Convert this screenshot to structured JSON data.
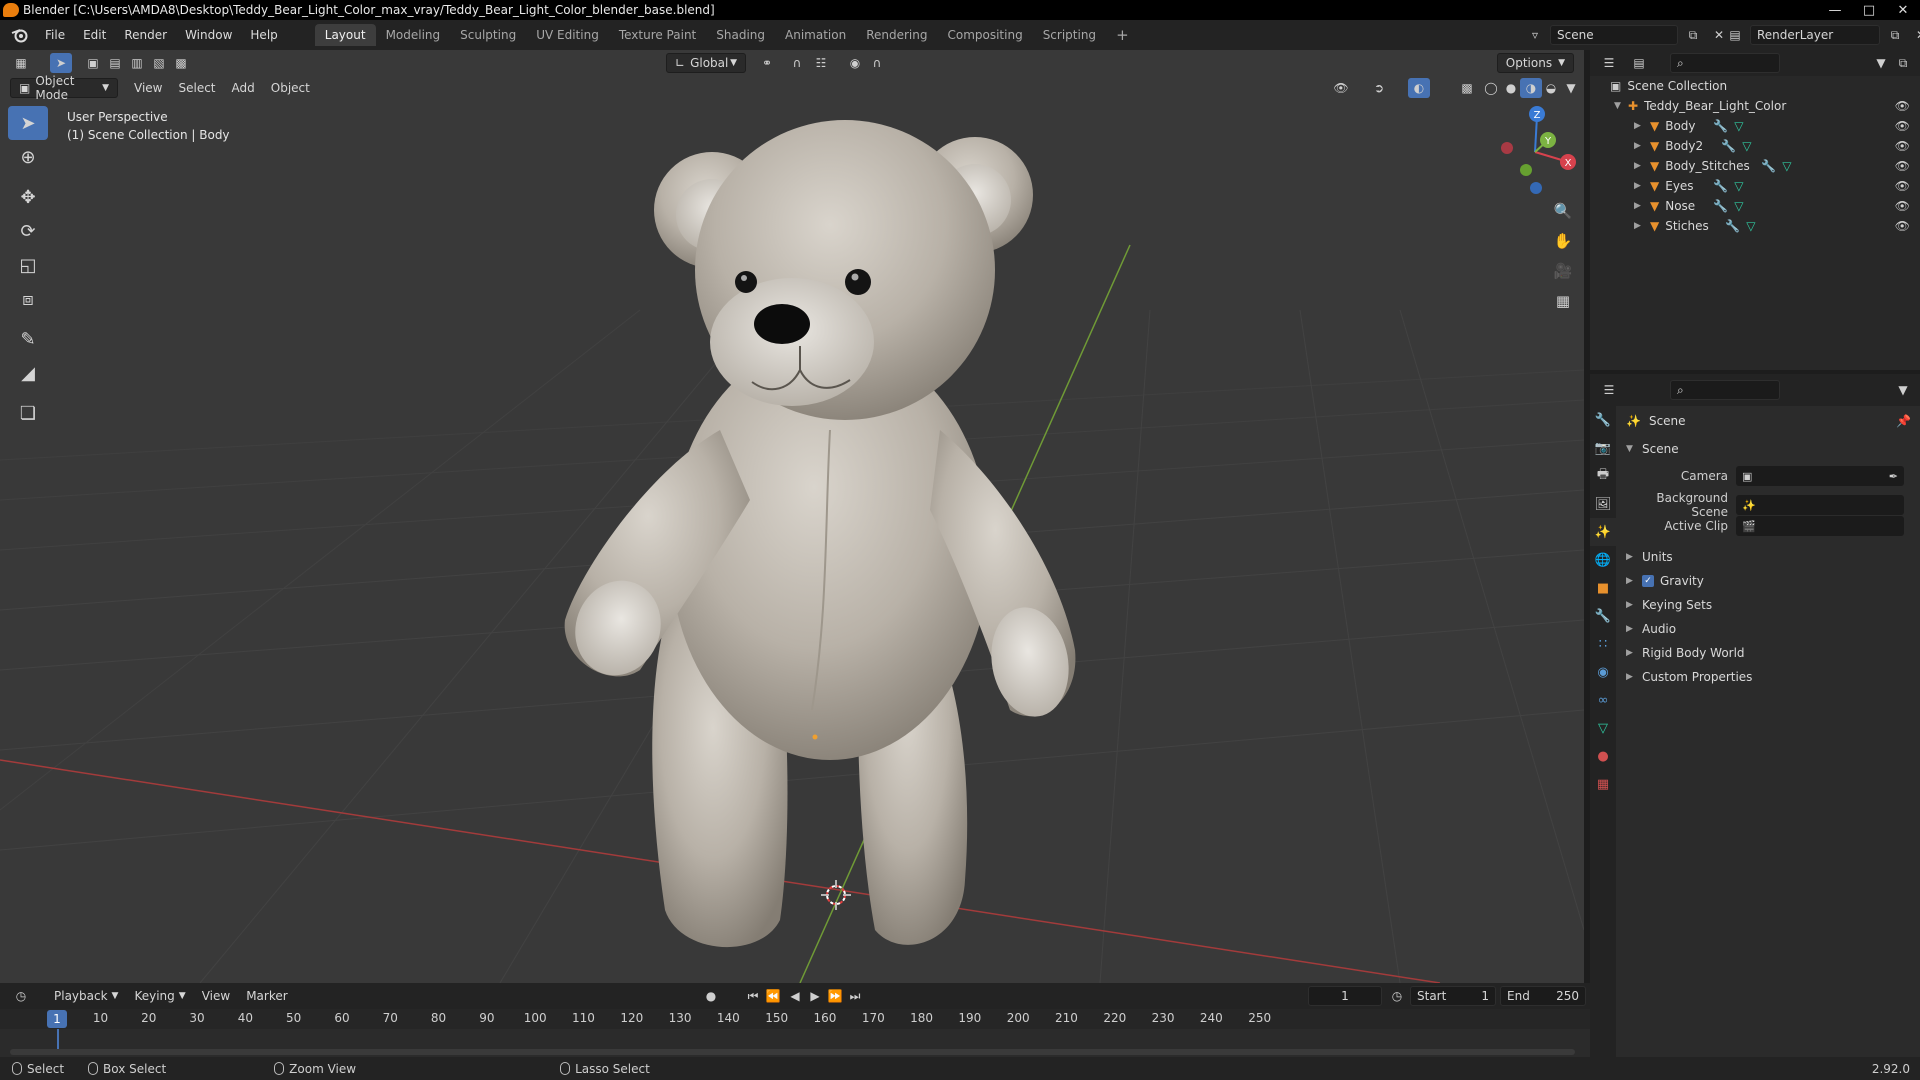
{
  "window": {
    "title": "Blender [C:\\Users\\AMDA8\\Desktop\\Teddy_Bear_Light_Color_max_vray/Teddy_Bear_Light_Color_blender_base.blend]"
  },
  "menu": [
    "File",
    "Edit",
    "Render",
    "Window",
    "Help"
  ],
  "workspaces": [
    "Layout",
    "Modeling",
    "Sculpting",
    "UV Editing",
    "Texture Paint",
    "Shading",
    "Animation",
    "Rendering",
    "Compositing",
    "Scripting"
  ],
  "active_workspace": "Layout",
  "topbar": {
    "scene": "Scene",
    "render_layer": "RenderLayer",
    "add_tab": "+"
  },
  "viewport": {
    "mode": "Object Mode",
    "menus": [
      "View",
      "Select",
      "Add",
      "Object"
    ],
    "orientation": "Global",
    "options_label": "Options",
    "info_line1": "User Perspective",
    "info_line2": "(1) Scene Collection | Body",
    "gizmo": {
      "x": "X",
      "y": "Y",
      "z": "Z"
    }
  },
  "outliner": {
    "root": "Scene Collection",
    "collection": "Teddy_Bear_Light_Color",
    "objects": [
      "Body",
      "Body2",
      "Body_Stitches",
      "Eyes",
      "Nose",
      "Stiches"
    ]
  },
  "properties": {
    "context_title": "Scene",
    "panel_title": "Scene",
    "camera_label": "Camera",
    "background_label": "Background Scene",
    "clip_label": "Active Clip",
    "panels": [
      "Units",
      "Gravity",
      "Keying Sets",
      "Audio",
      "Rigid Body World",
      "Custom Properties"
    ],
    "gravity_checked": true
  },
  "timeline": {
    "menus": [
      "Playback",
      "Keying",
      "View",
      "Marker"
    ],
    "current_frame": "1",
    "start_label": "Start",
    "start_value": "1",
    "end_label": "End",
    "end_value": "250",
    "ticks": [
      "1",
      "10",
      "20",
      "30",
      "40",
      "50",
      "60",
      "70",
      "80",
      "90",
      "100",
      "110",
      "120",
      "130",
      "140",
      "150",
      "160",
      "170",
      "180",
      "190",
      "200",
      "210",
      "220",
      "230",
      "240",
      "250"
    ]
  },
  "statusbar": {
    "select": "Select",
    "box_select": "Box Select",
    "zoom_view": "Zoom View",
    "lasso_select": "Lasso Select",
    "version": "2.92.0"
  },
  "colors": {
    "accent": "#4772b3",
    "object_orange": "#e8912d",
    "axis_x": "#d7424d",
    "axis_y": "#7cb342",
    "axis_z": "#3a7bd5"
  }
}
